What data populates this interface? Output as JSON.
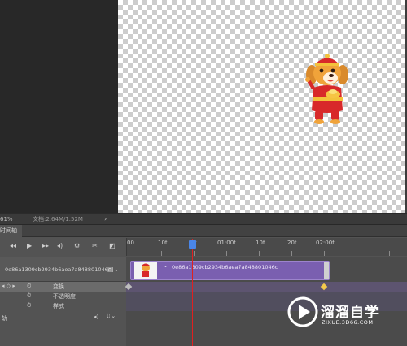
{
  "status": {
    "zoom": "61%",
    "doc": "文档:2.64M/1.52M",
    "arrow": "›"
  },
  "panel": {
    "tab_label": "时间轴"
  },
  "controls": {
    "first": "⏮",
    "prev": "◀︎",
    "play": "▶",
    "next": "▶︎",
    "audio": "🔊",
    "settings": "⚙",
    "split": "✂",
    "transition": "◩"
  },
  "ruler": {
    "labels": [
      "00",
      "10f",
      "01:00f",
      "10f",
      "20f",
      "02:00f"
    ],
    "playhead_label": "f"
  },
  "layer": {
    "name": "0e86a1309cb2934b6aea7a848801046c",
    "clip_name": "0e86a1309cb2934b6aea7a848801046c"
  },
  "properties": [
    {
      "label": "变换"
    },
    {
      "label": "不透明度"
    },
    {
      "label": "样式"
    }
  ],
  "audio_track": {
    "label": "轨"
  },
  "watermark": {
    "title": "溜溜自学",
    "subtitle": "ZIXUE.3D66.COM"
  },
  "colors": {
    "clip": "#7a5fb0",
    "playhead": "#e02020",
    "keyframe_start": "#bdbdbd",
    "keyframe_end": "#f2c94c"
  }
}
